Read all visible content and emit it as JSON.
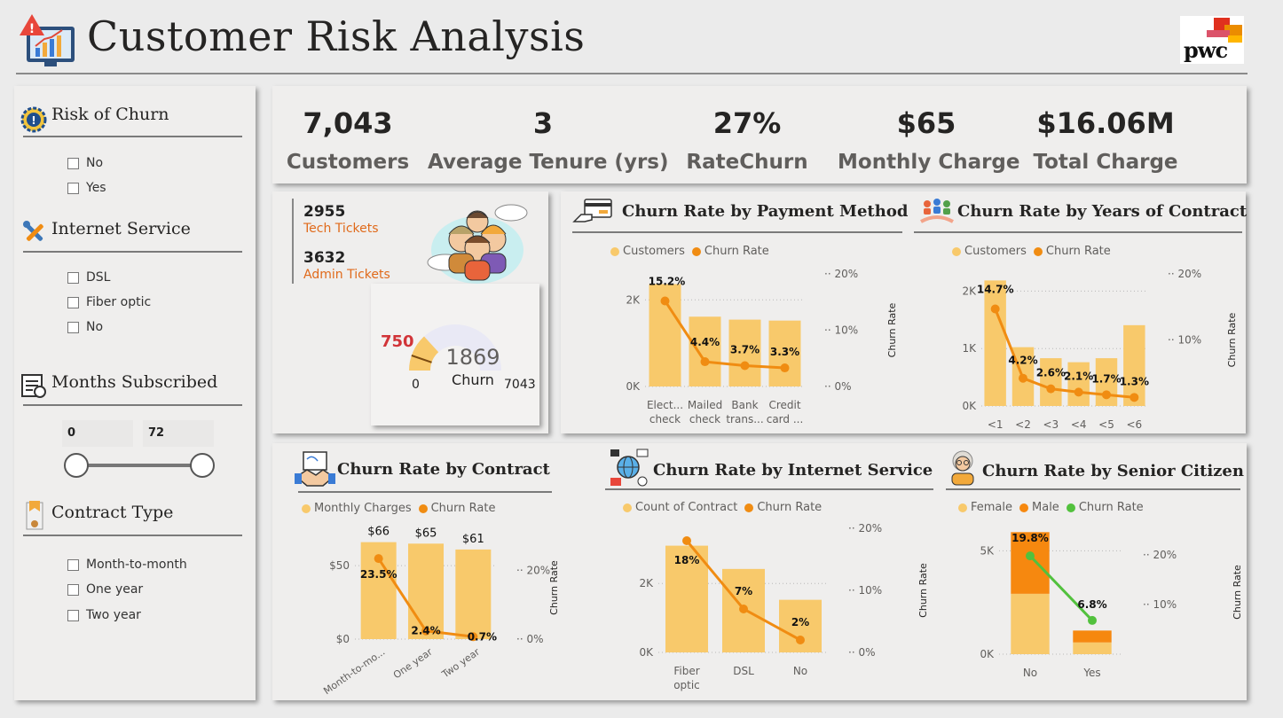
{
  "header": {
    "title": "Customer Risk Analysis",
    "logo_text": "pwc"
  },
  "slicers": {
    "churn": {
      "title": "Risk of Churn",
      "options": [
        "No",
        "Yes"
      ]
    },
    "internet": {
      "title": "Internet Service",
      "options": [
        "DSL",
        "Fiber optic",
        "No"
      ]
    },
    "months": {
      "title": "Months Subscribed",
      "min": "0",
      "max": "72"
    },
    "contract": {
      "title": "Contract Type",
      "options": [
        "Month-to-month",
        "One year",
        "Two year"
      ]
    }
  },
  "kpis": [
    {
      "value": "7,043",
      "label": "Customers"
    },
    {
      "value": "3",
      "label": "Average Tenure (yrs)"
    },
    {
      "value": "27%",
      "label": "RateChurn"
    },
    {
      "value": "$65",
      "label": "Monthly Charge"
    },
    {
      "value": "$16.06M",
      "label": "Total Charge"
    }
  ],
  "tickets": {
    "tech_value": "2955",
    "tech_label": "Tech Tickets",
    "admin_value": "3632",
    "admin_label": "Admin Tickets"
  },
  "gauge": {
    "value": "1869",
    "label": "Churn",
    "min": "0",
    "max": "7043",
    "target": "750",
    "fraction": 0.265,
    "target_fraction": 0.106
  },
  "colors": {
    "bar": "#f8c96b",
    "line": "#f08c12",
    "male": "#f6880f",
    "rate_green": "#52c13d",
    "target": "#d13438"
  },
  "charts": {
    "payment": {
      "title": "Churn Rate by Payment Method",
      "legend": [
        "Customers",
        "Churn Rate"
      ],
      "y2_label": "Churn Rate",
      "y_ticks": [
        "2K",
        "0K"
      ],
      "y2_ticks": [
        "20%",
        "10%",
        "0%"
      ],
      "cat1": [
        "Elect...",
        "Mailed",
        "Bank",
        "Credit"
      ],
      "cat2": [
        "check",
        "check",
        "trans...",
        "card ..."
      ],
      "rate_labels": [
        "15.2%",
        "4.4%",
        "3.7%",
        "3.3%"
      ]
    },
    "years": {
      "title": "Churn Rate by Years of Contract",
      "legend": [
        "Customers",
        "Churn Rate"
      ],
      "y2_label": "Churn Rate",
      "y_ticks": [
        "2K",
        "1K",
        "0K"
      ],
      "y2_ticks": [
        "20%",
        "10%"
      ],
      "categories": [
        "<1",
        "<2",
        "<3",
        "<4",
        "<5",
        "<6"
      ],
      "rate_labels": [
        "14.7%",
        "4.2%",
        "2.6%",
        "2.1%",
        "1.7%",
        "1.3%"
      ]
    },
    "contract": {
      "title": "Churn Rate by Contract",
      "legend": [
        "Monthly Charges",
        "Churn Rate"
      ],
      "y2_label": "Churn Rate",
      "y_ticks": [
        "$50",
        "$0"
      ],
      "y2_ticks": [
        "20%",
        "0%"
      ],
      "categories": [
        "Month-to-mo...",
        "One year",
        "Two year"
      ],
      "value_labels": [
        "$66",
        "$65",
        "$61"
      ],
      "rate_labels": [
        "23.5%",
        "2.4%",
        "0.7%"
      ]
    },
    "internet": {
      "title": "Churn Rate by Internet Service",
      "legend": [
        "Count of Contract",
        "Churn Rate"
      ],
      "y2_label": "Churn Rate",
      "y_ticks": [
        "2K",
        "0K"
      ],
      "y2_ticks": [
        "20%",
        "10%",
        "0%"
      ],
      "cat1": [
        "Fiber",
        "DSL",
        "No"
      ],
      "cat2": [
        "optic",
        "",
        ""
      ],
      "rate_labels": [
        "18%",
        "7%",
        "2%"
      ]
    },
    "senior": {
      "title": "Churn Rate by Senior Citizen",
      "legend": [
        "Female",
        "Male",
        "Churn Rate"
      ],
      "y2_label": "Churn Rate",
      "y_ticks": [
        "5K",
        "0K"
      ],
      "y2_ticks": [
        "20%",
        "10%"
      ],
      "categories": [
        "No",
        "Yes"
      ],
      "rate_labels": [
        "19.8%",
        "6.8%"
      ]
    }
  },
  "chart_data": [
    {
      "type": "bar",
      "title": "Churn Rate by Payment Method",
      "categories": [
        "Electronic check",
        "Mailed check",
        "Bank transfer",
        "Credit card"
      ],
      "series": [
        {
          "name": "Customers",
          "values": [
            2365,
            1612,
            1544,
            1522
          ]
        },
        {
          "name": "Churn Rate",
          "values": [
            15.2,
            4.4,
            3.7,
            3.3
          ]
        }
      ],
      "ylim": [
        0,
        2600
      ],
      "y2lim": [
        0,
        20
      ]
    },
    {
      "type": "bar",
      "title": "Churn Rate by Years of Contract",
      "categories": [
        "<1",
        "<2",
        "<3",
        "<4",
        "<5",
        "<6"
      ],
      "series": [
        {
          "name": "Customers",
          "values": [
            2186,
            1024,
            832,
            762,
            832,
            1407
          ]
        },
        {
          "name": "Churn Rate",
          "values": [
            14.7,
            4.2,
            2.6,
            2.1,
            1.7,
            1.3
          ]
        }
      ],
      "ylim": [
        0,
        2300
      ],
      "y2lim": [
        0,
        20
      ]
    },
    {
      "type": "bar",
      "title": "Churn Rate by Contract",
      "categories": [
        "Month-to-month",
        "One year",
        "Two year"
      ],
      "series": [
        {
          "name": "Monthly Charges",
          "values": [
            66,
            65,
            61
          ]
        },
        {
          "name": "Churn Rate",
          "values": [
            23.5,
            2.4,
            0.7
          ]
        }
      ],
      "ylim": [
        0,
        70
      ],
      "y2lim": [
        0,
        30
      ]
    },
    {
      "type": "bar",
      "title": "Churn Rate by Internet Service",
      "categories": [
        "Fiber optic",
        "DSL",
        "No"
      ],
      "series": [
        {
          "name": "Count of Contract",
          "values": [
            3096,
            2421,
            1526
          ]
        },
        {
          "name": "Churn Rate",
          "values": [
            18,
            7,
            2
          ]
        }
      ],
      "ylim": [
        0,
        3600
      ],
      "y2lim": [
        0,
        20
      ]
    },
    {
      "type": "bar",
      "title": "Churn Rate by Senior Citizen",
      "categories": [
        "No",
        "Yes"
      ],
      "series": [
        {
          "name": "Female",
          "values": [
            2920,
            568
          ]
        },
        {
          "name": "Male",
          "values": [
            2981,
            574
          ]
        },
        {
          "name": "Churn Rate",
          "values": [
            19.8,
            6.8
          ]
        }
      ],
      "ylim": [
        0,
        6000
      ],
      "y2lim": [
        0,
        25
      ]
    }
  ]
}
